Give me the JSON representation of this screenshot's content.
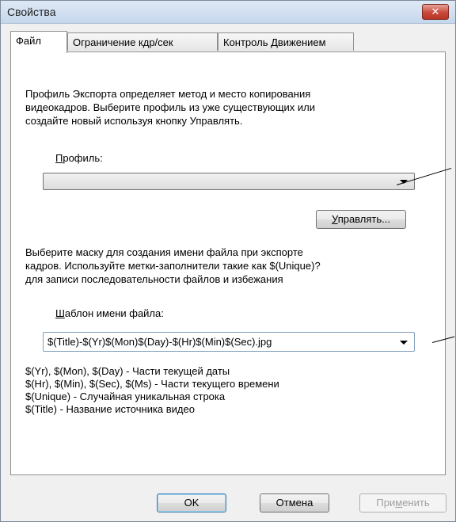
{
  "window": {
    "title": "Свойства",
    "close_glyph": "✕"
  },
  "tabs": [
    {
      "label": "Файл"
    },
    {
      "label": "Ограничение кдр/сек"
    },
    {
      "label": "Контроль Движением"
    }
  ],
  "export": {
    "description_lines": [
      "Профиль Экспорта определяет метод и место копирования",
      "видеокадров. Выберите профиль из уже существующих или",
      "создайте новый используя кнопку Управлять."
    ],
    "profile_label_accel": "П",
    "profile_label_rest": "рофиль:",
    "profile_value": "",
    "manage_button_accel": "У",
    "manage_button_rest": "правлять..."
  },
  "mask": {
    "description_lines": [
      "Выберите маску для создания имени файла при экспорте",
      "кадров. Используйте метки-заполнители такие как $(Unique)?",
      "для записи последовательности файлов и избежания"
    ],
    "template_label_accel": "Ш",
    "template_label_rest": "аблон имени файла:",
    "template_value": "$(Title)-$(Yr)$(Mon)$(Day)-$(Hr)$(Min)$(Sec).jpg",
    "hints": [
      "$(Yr), $(Mon), $(Day) - Части текущей даты",
      "$(Hr), $(Min), $(Sec), $(Ms) - Части текущего времени",
      "$(Unique) - Случайная уникальная строка",
      "$(Title) - Название источника видео"
    ]
  },
  "footer": {
    "ok_label": "OK",
    "cancel_label": "Отмена",
    "apply_label_pre": "При",
    "apply_label_accel": "м",
    "apply_label_post": "енить"
  }
}
